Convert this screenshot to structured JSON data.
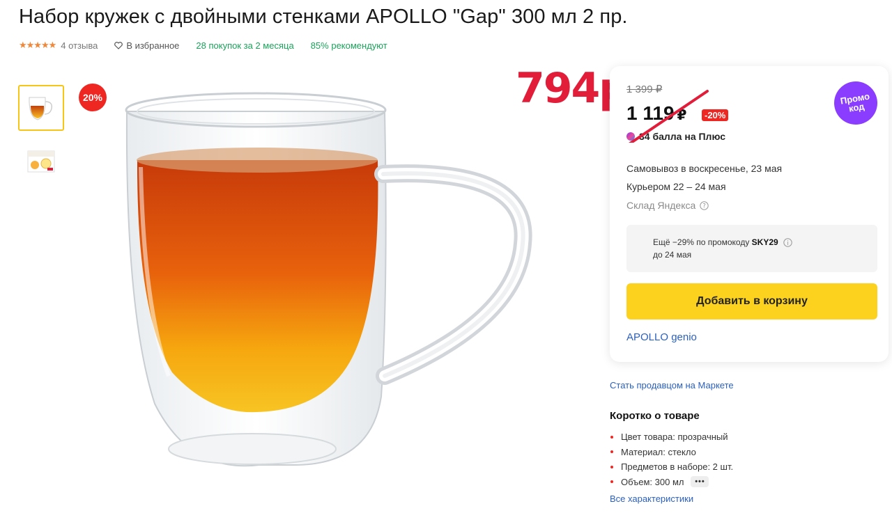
{
  "product": {
    "title": "Набор кружек с двойными стенками APOLLO \"Gap\" 300 мл 2 пр.",
    "rating_stars": "★★★★★",
    "reviews": "4 отзыва",
    "favorite": "В избранное",
    "purchases": "28 покупок за 2 месяца",
    "recommend": "85% рекомендуют",
    "discount_badge": "20%"
  },
  "annotation": {
    "handwritten_price": "794р."
  },
  "offer": {
    "old_price": "1 399 ₽",
    "price": "1 119",
    "currency": "₽",
    "discount": "-20%",
    "plus_points": "34 балла на Плюс",
    "promo_sticker_line1": "Промо",
    "promo_sticker_line2": "код",
    "pickup": "Самовывоз в воскресенье, 23 мая",
    "courier": "Курьером 22 – 24 мая",
    "warehouse": "Склад Яндекса",
    "promo_text_prefix": "Ещё −29% по промокоду ",
    "promo_code": "SKY29",
    "promo_until": "до 24 мая",
    "add_to_cart": "Добавить в корзину",
    "seller": "APOLLO genio"
  },
  "sidebar": {
    "become_seller": "Стать продавцом на Маркете",
    "short_title": "Коротко о товаре",
    "specs": [
      "Цвет товара: прозрачный",
      "Материал: стекло",
      "Предметов в наборе: 2 шт.",
      "Объем: 300 мл"
    ],
    "more": "•••",
    "all_specs": "Все характеристики"
  },
  "colors": {
    "accent_yellow": "#fdd21f",
    "discount_red": "#ee2722",
    "link_blue": "#2a5fbf",
    "green": "#1aa35a",
    "promo_purple": "#8b3dff"
  }
}
